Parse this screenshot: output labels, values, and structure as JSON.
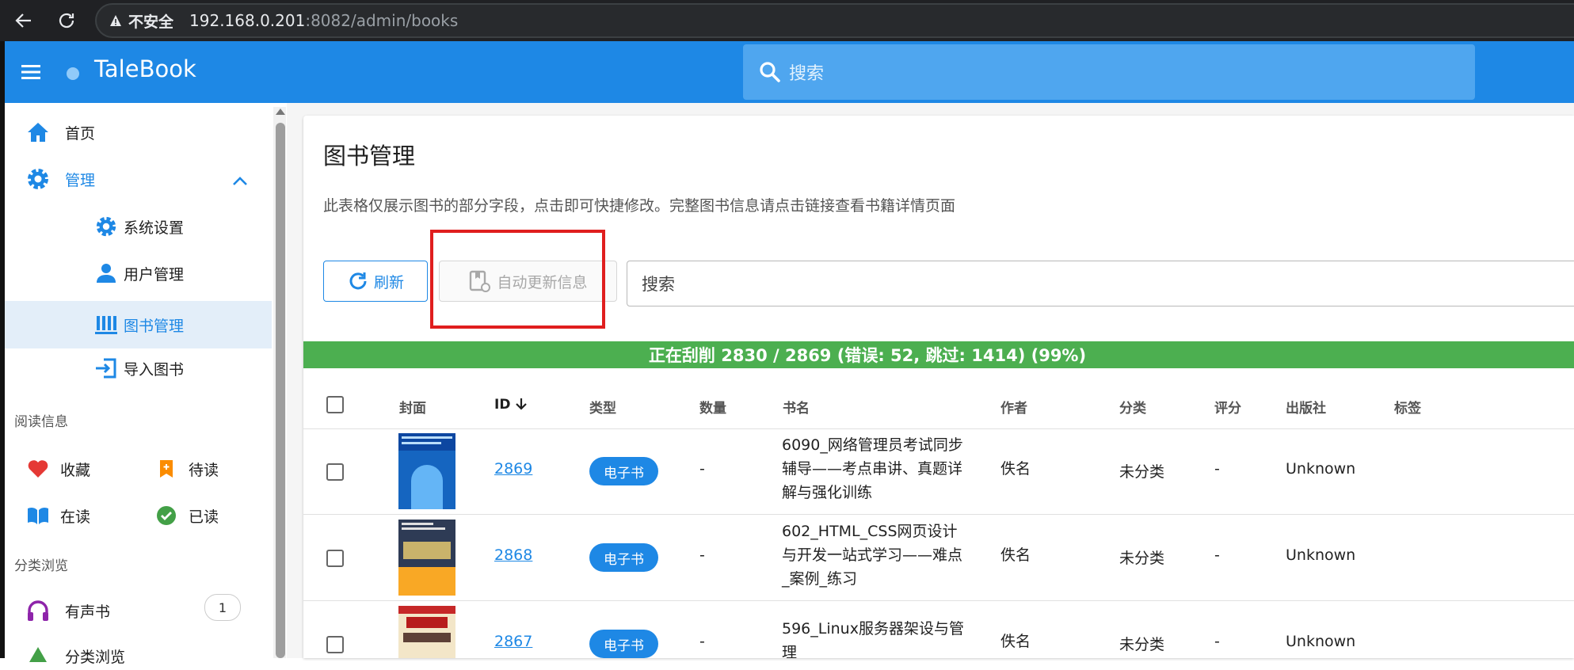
{
  "browser": {
    "warning": "不安全",
    "url_host": "192.168.0.201",
    "url_rest": ":8082/admin/books"
  },
  "appbar": {
    "title": "TaleBook",
    "search_placeholder": "搜索"
  },
  "sidebar": {
    "home": "首页",
    "admin": "管理",
    "sub": {
      "settings": "系统设置",
      "users": "用户管理",
      "books": "图书管理",
      "import": "导入图书"
    },
    "reading_section": "阅读信息",
    "reading": {
      "favorites": "收藏",
      "to_read": "待读",
      "reading": "在读",
      "read": "已读"
    },
    "category_section": "分类浏览",
    "audiobooks": "有声书",
    "audiobooks_count": "1",
    "browse": "分类浏览"
  },
  "page": {
    "title": "图书管理",
    "description": "此表格仅展示图书的部分字段，点击即可快捷修改。完整图书信息请点击链接查看书籍详情页面",
    "refresh_label": "刷新",
    "auto_update_label": "自动更新信息",
    "search_placeholder": "搜索",
    "progress_text": "正在刮削 2830 / 2869 (错误: 52, 跳过: 1414) (99%)"
  },
  "table": {
    "headers": {
      "cover": "封面",
      "id": "ID",
      "type": "类型",
      "count": "数量",
      "title": "书名",
      "author": "作者",
      "category": "分类",
      "rating": "评分",
      "publisher": "出版社",
      "tags": "标签"
    },
    "rows": [
      {
        "id": "2869",
        "type": "电子书",
        "count": "-",
        "title": "6090_网络管理员考试同步辅导——考点串讲、真题详解与强化训练",
        "author": "佚名",
        "category": "未分类",
        "rating": "-",
        "publisher": "Unknown"
      },
      {
        "id": "2868",
        "type": "电子书",
        "count": "-",
        "title": "602_HTML_CSS网页设计与开发一站式学习——难点_案例_练习",
        "author": "佚名",
        "category": "未分类",
        "rating": "-",
        "publisher": "Unknown"
      },
      {
        "id": "2867",
        "type": "电子书",
        "count": "-",
        "title": "596_Linux服务器架设与管理",
        "author": "佚名",
        "category": "未分类",
        "rating": "-",
        "publisher": "Unknown"
      }
    ]
  },
  "colors": {
    "primary": "#1e88e5",
    "progress": "#4caf50",
    "highlight": "#e01e1e"
  }
}
